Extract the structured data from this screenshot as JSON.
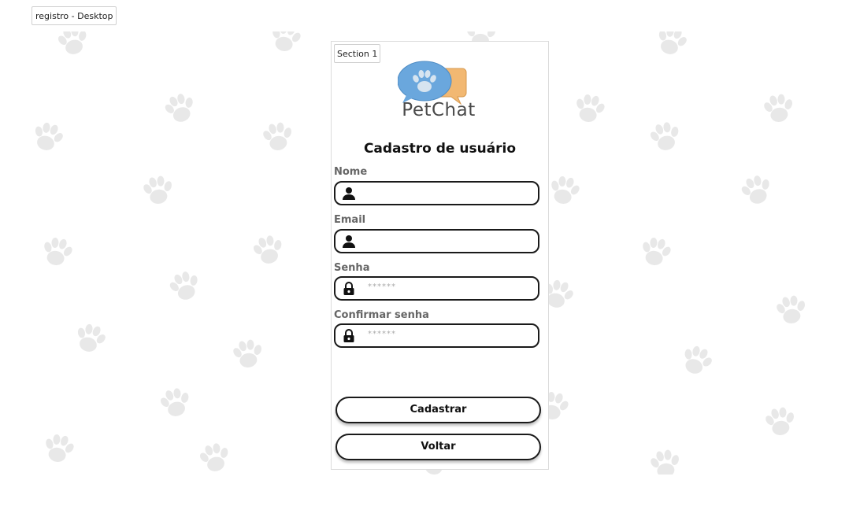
{
  "frame": {
    "label": "registro - Desktop"
  },
  "section": {
    "label": "Section 1"
  },
  "logo": {
    "text": "PetChat",
    "icon": "paw-chat-bubbles-icon",
    "colors": {
      "blue_bubble": "#6aa7dd",
      "orange_bubble": "#f2b872",
      "paw": "#c9d9e8"
    }
  },
  "title": "Cadastro de usuário",
  "form": {
    "nome": {
      "label": "Nome",
      "icon": "user-icon",
      "value": "",
      "placeholder": ""
    },
    "email": {
      "label": "Email",
      "icon": "user-icon",
      "value": "",
      "placeholder": ""
    },
    "senha": {
      "label": "Senha",
      "icon": "lock-icon",
      "value": "",
      "placeholder": "******"
    },
    "confirmar": {
      "label": "Confirmar senha",
      "icon": "lock-icon",
      "value": "",
      "placeholder": "******"
    }
  },
  "buttons": {
    "cadastrar": "Cadastrar",
    "voltar": "Voltar"
  },
  "background": {
    "pattern_icon": "paw-print-icon",
    "pattern_color": "#e6e6e6"
  }
}
